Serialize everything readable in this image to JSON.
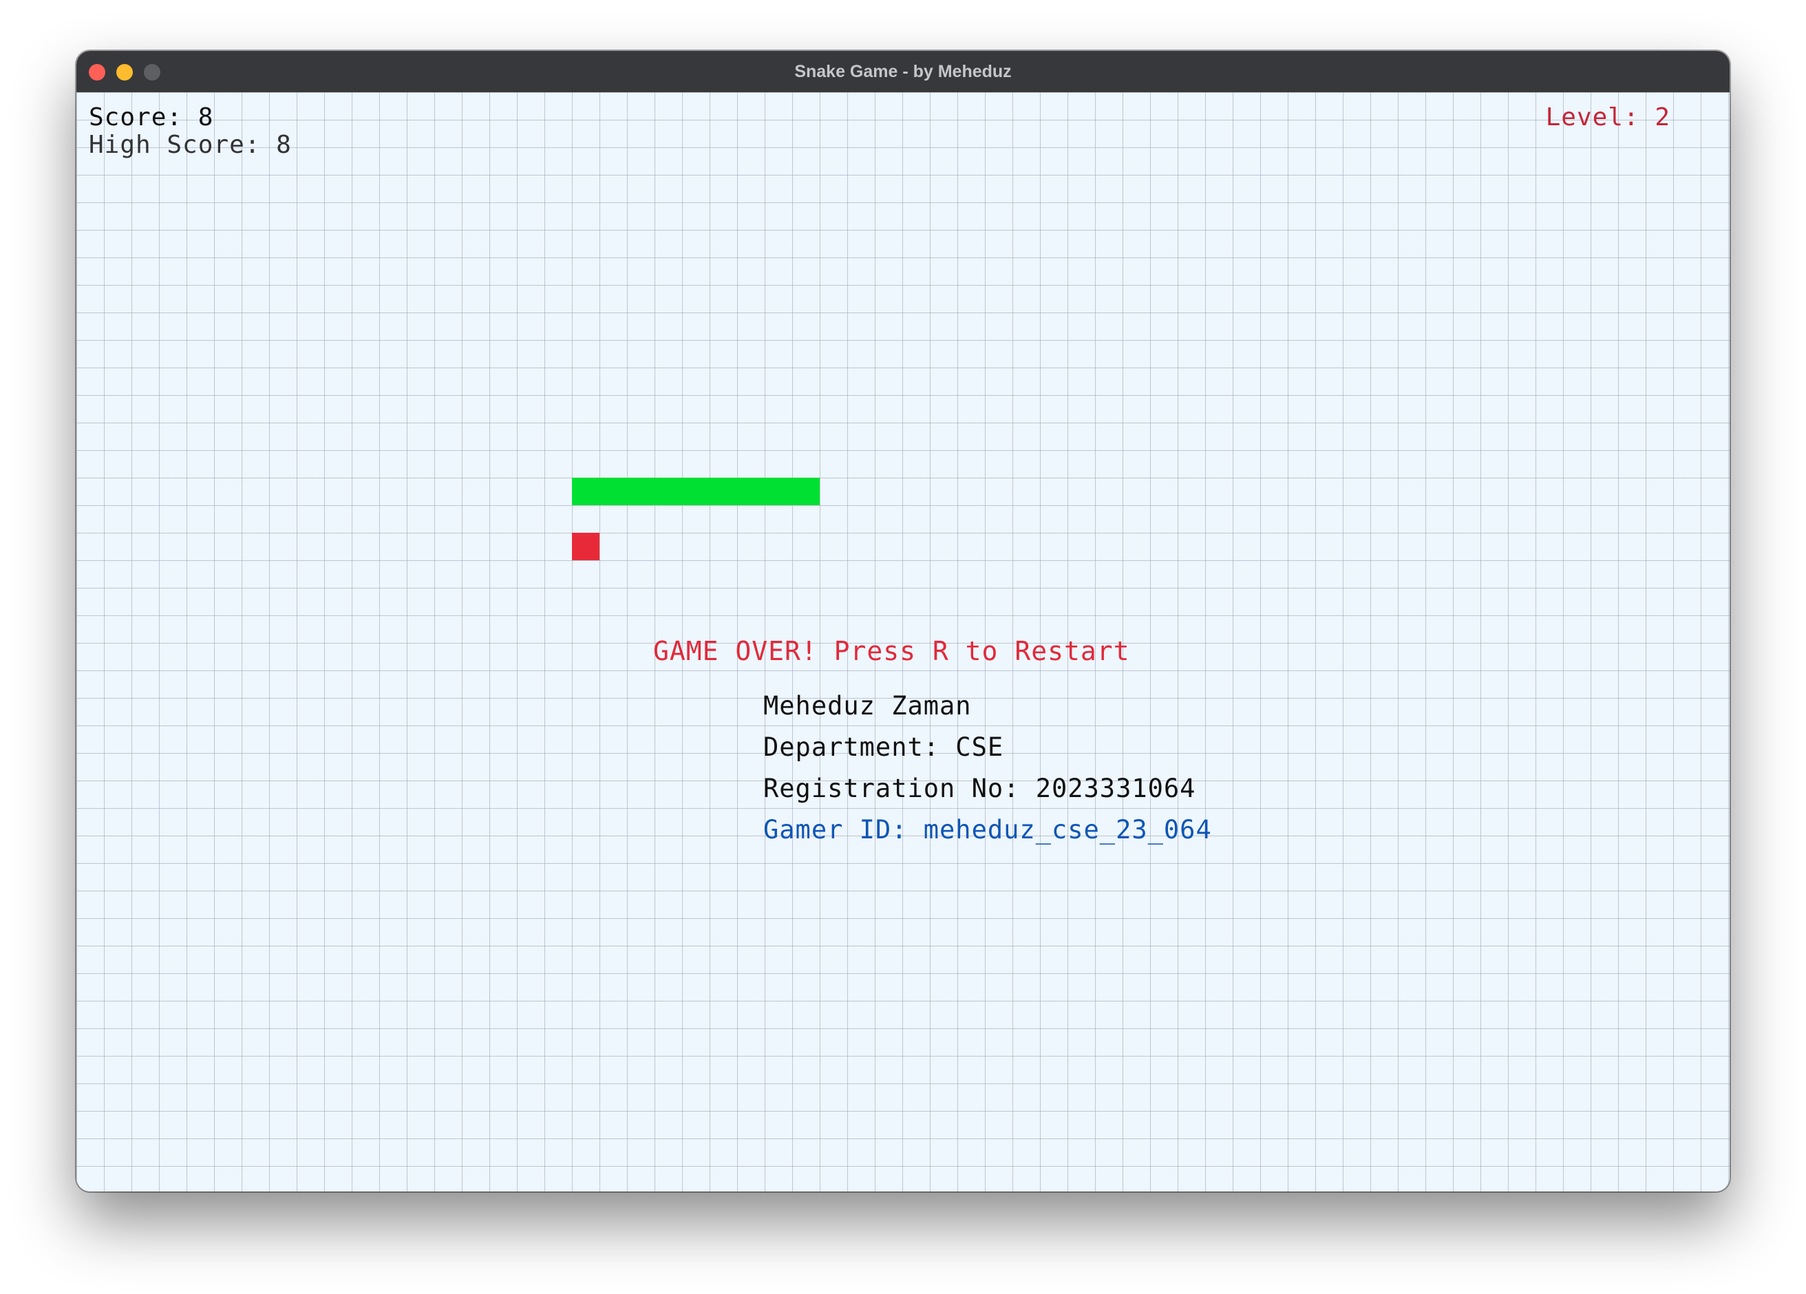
{
  "window": {
    "title": "Snake Game - by Meheduz"
  },
  "hud": {
    "score": "Score: 8",
    "high_score": "High Score: 8",
    "level": "Level: 2"
  },
  "game": {
    "snake_length_cells": 9,
    "game_over_message": "GAME OVER! Press R to Restart"
  },
  "player_info": {
    "name": "Meheduz Zaman",
    "department": "Department: CSE",
    "registration": "Registration No: 2023331064",
    "gamer_id": "Gamer ID: meheduz_cse_23_064"
  },
  "colors": {
    "snake": "#00e032",
    "food": "#e82a38",
    "level_text": "#c42638",
    "game_over_text": "#e02a3a",
    "gamer_id_text": "#0e56b5",
    "board_background": "#eef6fe"
  }
}
